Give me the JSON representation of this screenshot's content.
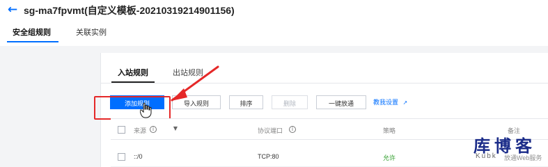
{
  "header": {
    "title": "sg-ma7fpvmt(自定义模板-20210319214901156)",
    "back_icon": "back-arrow-icon"
  },
  "tabs": [
    {
      "label": "安全组规则",
      "active": true
    },
    {
      "label": "关联实例",
      "active": false
    }
  ],
  "inner_tabs": [
    {
      "label": "入站规则",
      "active": true
    },
    {
      "label": "出站规则",
      "active": false
    }
  ],
  "toolbar": {
    "add_rule": "添加规则",
    "import_rule": "导入规则",
    "sort": "排序",
    "delete": "删除",
    "allow_all": "一键放通",
    "help_link": "教我设置",
    "help_icon": "external-link-icon"
  },
  "table": {
    "headers": {
      "source": "来源",
      "source_info_icon": "info-icon",
      "filter_icon": "filter-icon",
      "protocol_port": "协议端口",
      "protocol_info_icon": "info-icon",
      "policy": "策略",
      "note": "备注"
    },
    "rows": [
      {
        "source": "::/0",
        "protocol_port": "TCP:80",
        "policy": "允许",
        "note": "放通Web服务"
      }
    ]
  },
  "annotations": {
    "highlight_color": "#e52828",
    "arrow_color": "#e52828"
  },
  "watermark": {
    "main": "库博客",
    "sub": "Kubk"
  },
  "colors": {
    "brand_blue": "#006eff",
    "allow_green": "#2c9d28",
    "watermark_blue": "#1b2c89"
  }
}
